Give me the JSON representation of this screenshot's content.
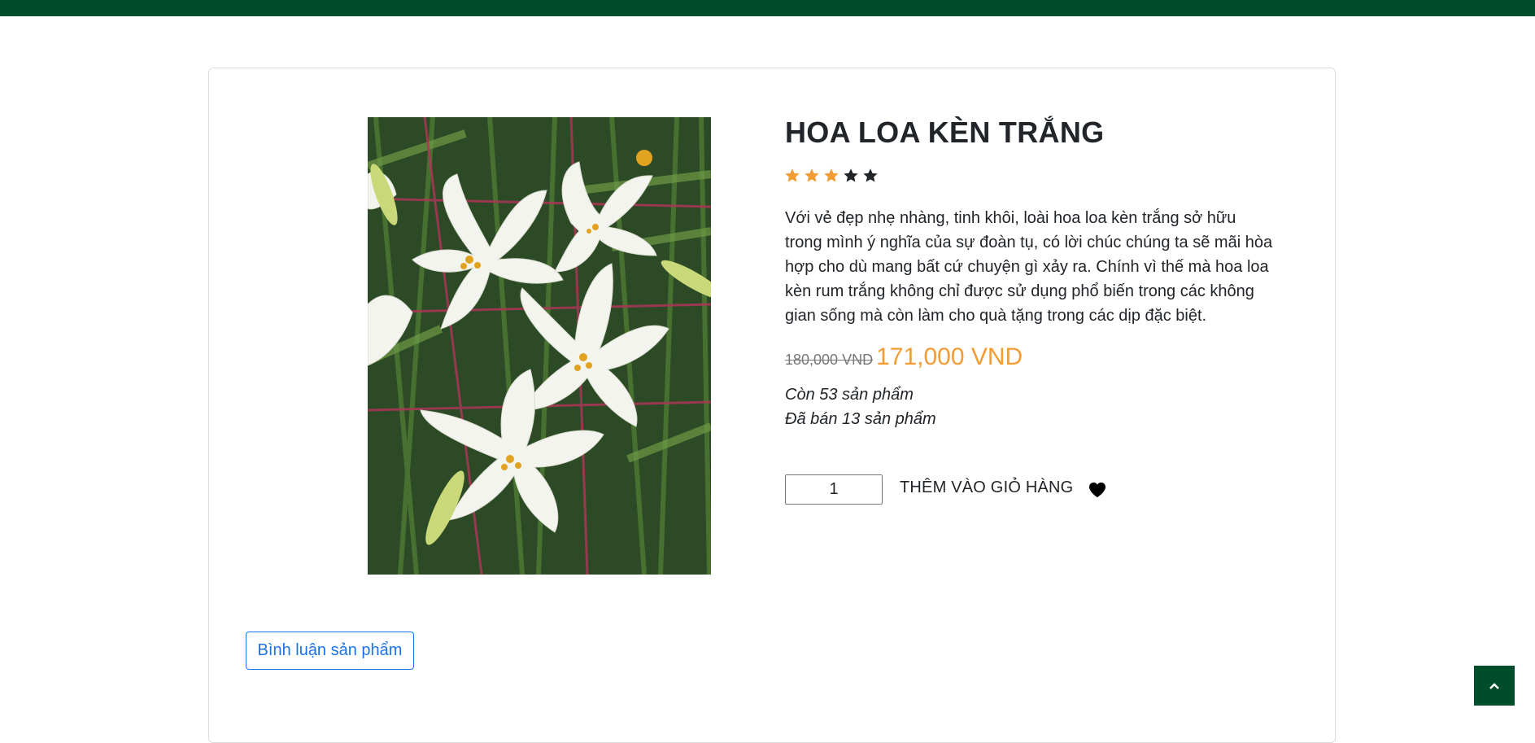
{
  "colors": {
    "top_bar": "#004d2c",
    "star_filled": "#f39c33",
    "star_empty": "#212529",
    "price_accent": "#f39c33",
    "link_blue": "#1a73e8"
  },
  "product": {
    "title": "HOA LOA KÈN TRẮNG",
    "rating": {
      "value": 3,
      "max": 5
    },
    "description": "Với vẻ đẹp nhẹ nhàng, tinh khôi, loài hoa loa kèn trắng sở hữu trong mình ý nghĩa của sự đoàn tụ, có lời chúc chúng ta sẽ mãi hòa hợp cho dù mang bất cứ chuyện gì xảy ra. Chính vì thế mà hoa loa kèn rum trắng không chỉ được sử dụng phổ biến trong các không gian sống mà còn làm cho quà tặng trong các dịp đặc biệt.",
    "old_price": "180,000 VND",
    "new_price": "171,000 VND",
    "stock_text": "Còn 53 sản phẩm",
    "sold_text": "Đã bán 13 sản phẩm",
    "quantity": "1",
    "image_icon": "white-lily-photo"
  },
  "actions": {
    "add_to_cart_label": "THÊM VÀO GIỎ HÀNG",
    "favorite_icon": "heart-icon",
    "comment_button_label": "Bình luận sản phẩm",
    "back_to_top_icon": "chevron-up-icon"
  }
}
